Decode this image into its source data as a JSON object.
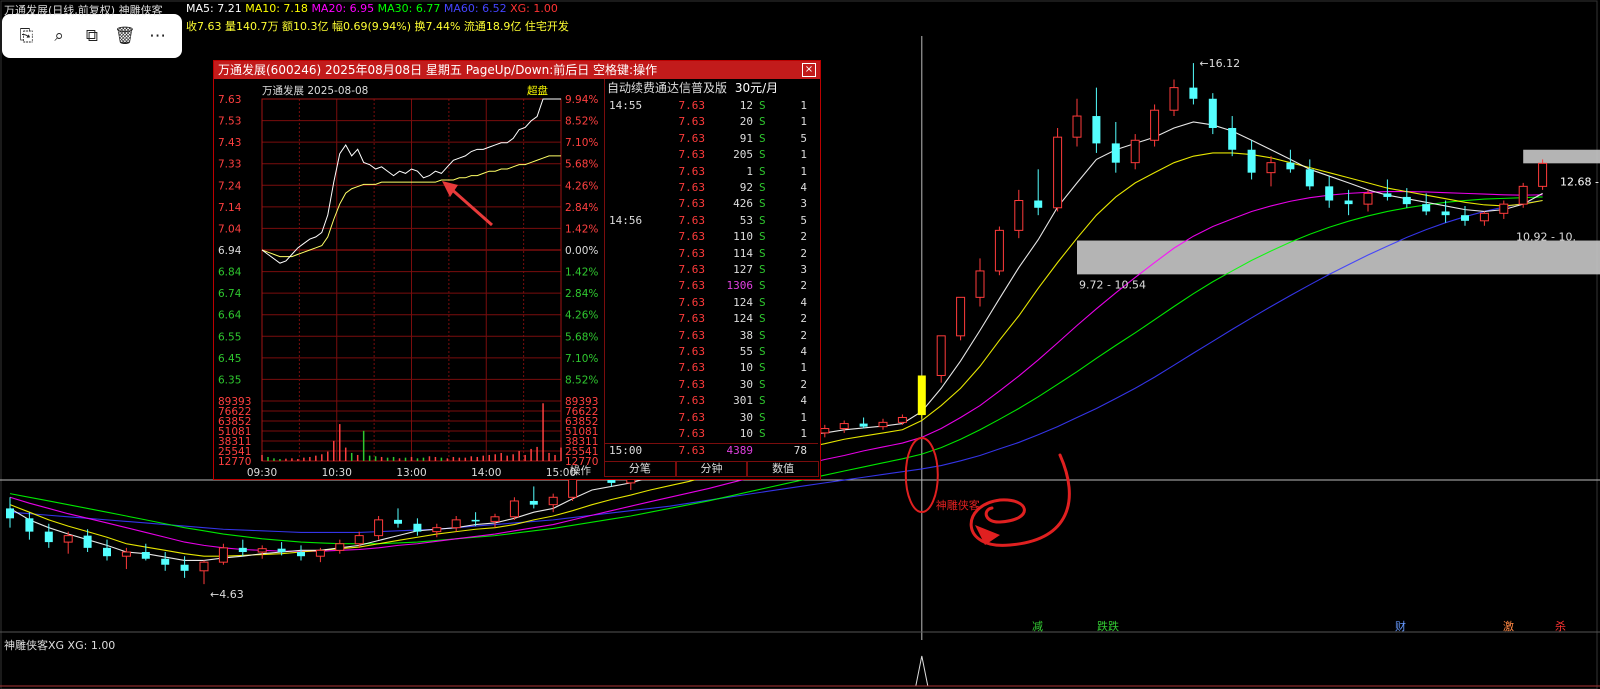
{
  "header": {
    "title": "万通发展(日线,前复权)",
    "indicator_name": "神雕侠客",
    "ma5": "MA5: 7.21",
    "ma10": "MA10: 7.18",
    "ma20": "MA20: 6.95",
    "ma30": "MA30: 6.77",
    "ma60": "MA60: 6.52",
    "xg": "XG: 1.00",
    "line2": "收7.63 量140.7万 额10.3亿 幅0.69(9.94%) 换7.44% 流通18.9亿 住宅开发"
  },
  "toolbar": {
    "icons": [
      "text-scan-icon",
      "image-search-icon",
      "crop-icon",
      "trash-icon",
      "more-icon"
    ],
    "labels": [
      "⎘",
      "⌕",
      "⧉",
      "🗑",
      "⋯"
    ]
  },
  "popup": {
    "title": "万通发展(600246) 2025年08月08日 星期五 PageUp/Down:前后日 空格键:操作",
    "chart_label": "万通发展  2025-08-08",
    "chart_mode": "超盘",
    "price_ticks": [
      "7.63",
      "7.53",
      "7.43",
      "7.33",
      "7.24",
      "7.14",
      "7.04",
      "6.94",
      "6.84",
      "6.74",
      "6.64",
      "6.55",
      "6.45",
      "6.35"
    ],
    "pct_ticks": [
      "9.94%",
      "8.52%",
      "7.10%",
      "5.68%",
      "4.26%",
      "2.84%",
      "1.42%",
      "0.00%",
      "1.42%",
      "2.84%",
      "4.26%",
      "5.68%",
      "7.10%",
      "8.52%"
    ],
    "vol_ticks": [
      "89393",
      "76622",
      "63852",
      "51081",
      "38311",
      "25541",
      "12770"
    ],
    "time_ticks": [
      "09:30",
      "10:30",
      "13:00",
      "14:00",
      "15:00"
    ],
    "op_label": "操作",
    "orderbook_header": "自动续费通达信普及版",
    "orderbook_price": "30元/月",
    "trades": [
      {
        "t": "14:55",
        "p": "7.63",
        "v": "12",
        "s": "S",
        "n": "1"
      },
      {
        "t": "",
        "p": "7.63",
        "v": "20",
        "s": "S",
        "n": "1"
      },
      {
        "t": "",
        "p": "7.63",
        "v": "91",
        "s": "S",
        "n": "5"
      },
      {
        "t": "",
        "p": "7.63",
        "v": "205",
        "s": "S",
        "n": "1"
      },
      {
        "t": "",
        "p": "7.63",
        "v": "1",
        "s": "S",
        "n": "1"
      },
      {
        "t": "",
        "p": "7.63",
        "v": "92",
        "s": "S",
        "n": "4"
      },
      {
        "t": "",
        "p": "7.63",
        "v": "426",
        "s": "S",
        "n": "3"
      },
      {
        "t": "14:56",
        "p": "7.63",
        "v": "53",
        "s": "S",
        "n": "5"
      },
      {
        "t": "",
        "p": "7.63",
        "v": "110",
        "s": "S",
        "n": "2"
      },
      {
        "t": "",
        "p": "7.63",
        "v": "114",
        "s": "S",
        "n": "2"
      },
      {
        "t": "",
        "p": "7.63",
        "v": "127",
        "s": "S",
        "n": "3"
      },
      {
        "t": "",
        "p": "7.63",
        "v": "1306",
        "s": "S",
        "n": "2"
      },
      {
        "t": "",
        "p": "7.63",
        "v": "124",
        "s": "S",
        "n": "4"
      },
      {
        "t": "",
        "p": "7.63",
        "v": "124",
        "s": "S",
        "n": "2"
      },
      {
        "t": "",
        "p": "7.63",
        "v": "38",
        "s": "S",
        "n": "2"
      },
      {
        "t": "",
        "p": "7.63",
        "v": "55",
        "s": "S",
        "n": "4"
      },
      {
        "t": "",
        "p": "7.63",
        "v": "10",
        "s": "S",
        "n": "1"
      },
      {
        "t": "",
        "p": "7.63",
        "v": "30",
        "s": "S",
        "n": "2"
      },
      {
        "t": "",
        "p": "7.63",
        "v": "301",
        "s": "S",
        "n": "4"
      },
      {
        "t": "",
        "p": "7.63",
        "v": "30",
        "s": "S",
        "n": "1"
      },
      {
        "t": "",
        "p": "7.63",
        "v": "10",
        "s": "S",
        "n": "1"
      },
      {
        "t": "15:00",
        "p": "7.63",
        "v": "4389",
        "s": "",
        "n": "78"
      }
    ],
    "tabs": [
      "分笔",
      "分钟",
      "数值"
    ]
  },
  "annotations": {
    "high": "16.12",
    "low": "4.63",
    "zone_right": "12.68 -",
    "zone_mid": "9.72 - 10.54",
    "zone_low": "10.92 - 10.",
    "signal_text": "神雕侠客",
    "tags": [
      "减",
      "跌跌",
      "财",
      "激",
      "杀"
    ]
  },
  "indicator": {
    "label": "神雕侠客XG  XG: 1.00"
  },
  "colors": {
    "up": "#ff3b3b",
    "down": "#54ffff",
    "ma5": "#ffffff",
    "ma10": "#ffff00",
    "ma20": "#ff00ff",
    "ma30": "#00ff00",
    "ma60": "#3a3aff",
    "zone": "#c8c8c8",
    "signal": "#ffff00",
    "accent": "#c21b1b"
  },
  "chart_data": {
    "type": "candlestick",
    "title": "万通发展(日线,前复权)",
    "price_range": [
      4.63,
      16.12
    ],
    "ohlc": [
      [
        5.55,
        5.7,
        5.3,
        5.42
      ],
      [
        5.42,
        5.5,
        5.15,
        5.25
      ],
      [
        5.25,
        5.35,
        5.05,
        5.12
      ],
      [
        5.12,
        5.25,
        4.98,
        5.2
      ],
      [
        5.2,
        5.28,
        5.0,
        5.05
      ],
      [
        5.05,
        5.15,
        4.9,
        4.95
      ],
      [
        4.95,
        5.05,
        4.8,
        5.0
      ],
      [
        5.0,
        5.1,
        4.9,
        4.92
      ],
      [
        4.92,
        5.0,
        4.78,
        4.85
      ],
      [
        4.85,
        4.95,
        4.7,
        4.78
      ],
      [
        4.78,
        4.9,
        4.63,
        4.88
      ],
      [
        4.88,
        5.1,
        4.85,
        5.05
      ],
      [
        5.05,
        5.15,
        4.95,
        5.0
      ],
      [
        5.0,
        5.08,
        4.92,
        5.04
      ],
      [
        5.04,
        5.12,
        4.96,
        5.0
      ],
      [
        5.0,
        5.08,
        4.9,
        4.95
      ],
      [
        4.95,
        5.05,
        4.88,
        5.02
      ],
      [
        5.02,
        5.15,
        4.98,
        5.1
      ],
      [
        5.1,
        5.25,
        5.05,
        5.2
      ],
      [
        5.2,
        5.45,
        5.15,
        5.4
      ],
      [
        5.4,
        5.55,
        5.3,
        5.35
      ],
      [
        5.35,
        5.42,
        5.2,
        5.25
      ],
      [
        5.25,
        5.35,
        5.18,
        5.3
      ],
      [
        5.3,
        5.45,
        5.25,
        5.4
      ],
      [
        5.4,
        5.5,
        5.32,
        5.38
      ],
      [
        5.38,
        5.48,
        5.3,
        5.44
      ],
      [
        5.44,
        5.7,
        5.4,
        5.65
      ],
      [
        5.65,
        5.85,
        5.55,
        5.6
      ],
      [
        5.6,
        5.75,
        5.5,
        5.7
      ],
      [
        5.7,
        6.1,
        5.65,
        6.05
      ],
      [
        6.05,
        6.3,
        5.95,
        6.0
      ],
      [
        6.0,
        6.15,
        5.85,
        5.9
      ],
      [
        5.9,
        6.05,
        5.8,
        6.0
      ],
      [
        6.0,
        6.2,
        5.95,
        6.15
      ],
      [
        6.15,
        6.4,
        6.05,
        6.1
      ],
      [
        6.1,
        6.25,
        6.0,
        6.2
      ],
      [
        6.2,
        6.45,
        6.15,
        6.4
      ],
      [
        6.4,
        6.7,
        6.35,
        6.65
      ],
      [
        6.65,
        6.8,
        6.5,
        6.55
      ],
      [
        6.55,
        6.7,
        6.45,
        6.6
      ],
      [
        6.6,
        6.75,
        6.55,
        6.7
      ],
      [
        6.7,
        6.8,
        6.6,
        6.65
      ],
      [
        6.65,
        6.78,
        6.58,
        6.72
      ],
      [
        6.72,
        6.85,
        6.65,
        6.8
      ],
      [
        6.8,
        6.9,
        6.72,
        6.75
      ],
      [
        6.75,
        6.88,
        6.7,
        6.82
      ],
      [
        6.82,
        6.95,
        6.78,
        6.9
      ],
      [
        6.94,
        7.63,
        6.88,
        7.63
      ],
      [
        7.63,
        8.39,
        7.5,
        8.39
      ],
      [
        8.39,
        9.2,
        8.3,
        9.2
      ],
      [
        9.2,
        10.1,
        9.0,
        9.8
      ],
      [
        9.8,
        10.9,
        9.7,
        10.8
      ],
      [
        10.8,
        11.9,
        10.6,
        11.6
      ],
      [
        11.6,
        12.5,
        11.2,
        11.4
      ],
      [
        11.4,
        13.8,
        11.3,
        13.5
      ],
      [
        13.5,
        14.8,
        13.2,
        14.2
      ],
      [
        14.2,
        15.2,
        13.0,
        13.3
      ],
      [
        13.3,
        14.0,
        12.4,
        12.7
      ],
      [
        12.7,
        13.6,
        12.5,
        13.4
      ],
      [
        13.4,
        14.6,
        13.2,
        14.4
      ],
      [
        14.4,
        15.5,
        14.2,
        15.2
      ],
      [
        15.2,
        16.12,
        14.6,
        14.8
      ],
      [
        14.8,
        15.0,
        13.6,
        13.8
      ],
      [
        13.8,
        14.2,
        12.9,
        13.1
      ],
      [
        13.1,
        13.4,
        12.2,
        12.4
      ],
      [
        12.4,
        12.9,
        12.0,
        12.7
      ],
      [
        12.7,
        13.1,
        12.4,
        12.5
      ],
      [
        12.5,
        12.8,
        11.9,
        12.0
      ],
      [
        12.0,
        12.3,
        11.4,
        11.6
      ],
      [
        11.6,
        11.9,
        11.2,
        11.5
      ],
      [
        11.5,
        11.9,
        11.3,
        11.8
      ],
      [
        11.8,
        12.2,
        11.6,
        11.7
      ],
      [
        11.7,
        11.95,
        11.4,
        11.5
      ],
      [
        11.5,
        11.8,
        11.2,
        11.3
      ],
      [
        11.3,
        11.6,
        11.0,
        11.2
      ],
      [
        11.2,
        11.45,
        10.92,
        11.05
      ],
      [
        11.05,
        11.3,
        10.92,
        11.25
      ],
      [
        11.25,
        11.6,
        11.1,
        11.5
      ],
      [
        11.5,
        12.1,
        11.4,
        12.0
      ],
      [
        12.0,
        12.8,
        11.9,
        12.68
      ]
    ],
    "ma5_line": [
      5.55,
      5.4,
      5.3,
      5.22,
      5.15,
      5.08,
      5.0,
      4.98,
      4.94,
      4.9,
      4.9,
      4.93,
      4.95,
      4.98,
      5.0,
      5.02,
      5.02,
      5.05,
      5.08,
      5.14,
      5.2,
      5.26,
      5.28,
      5.3,
      5.34,
      5.36,
      5.42,
      5.5,
      5.55,
      5.68,
      5.8,
      5.85,
      5.9,
      5.98,
      6.03,
      6.08,
      6.17,
      6.3,
      6.42,
      6.5,
      6.58,
      6.62,
      6.65,
      6.7,
      6.73,
      6.76,
      6.8,
      7.0,
      7.4,
      7.9,
      8.5,
      9.17,
      9.88,
      10.56,
      11.42,
      12.1,
      12.8,
      13.1,
      13.3,
      13.5,
      13.8,
      14.0,
      13.9,
      13.7,
      13.4,
      13.1,
      12.8,
      12.5,
      12.3,
      12.1,
      11.9,
      11.75,
      11.65,
      11.55,
      11.45,
      11.35,
      11.3,
      11.35,
      11.5,
      11.8
    ],
    "ma10_line": [
      5.6,
      5.5,
      5.4,
      5.32,
      5.25,
      5.18,
      5.1,
      5.06,
      5.02,
      4.98,
      4.95,
      4.95,
      4.96,
      4.97,
      4.98,
      5.0,
      5.02,
      5.04,
      5.06,
      5.1,
      5.14,
      5.18,
      5.22,
      5.25,
      5.28,
      5.3,
      5.34,
      5.4,
      5.45,
      5.52,
      5.6,
      5.67,
      5.73,
      5.8,
      5.86,
      5.92,
      6.0,
      6.1,
      6.2,
      6.28,
      6.35,
      6.42,
      6.48,
      6.55,
      6.6,
      6.65,
      6.7,
      6.85,
      7.1,
      7.4,
      7.8,
      8.3,
      8.8,
      9.4,
      10.0,
      10.6,
      11.2,
      11.7,
      12.1,
      12.4,
      12.7,
      12.9,
      13.0,
      13.0,
      12.95,
      12.85,
      12.7,
      12.55,
      12.4,
      12.25,
      12.1,
      11.95,
      11.85,
      11.75,
      11.65,
      11.55,
      11.48,
      11.45,
      11.5,
      11.6
    ],
    "ma20_line": [
      5.7,
      5.62,
      5.55,
      5.48,
      5.42,
      5.36,
      5.3,
      5.24,
      5.18,
      5.12,
      5.08,
      5.05,
      5.03,
      5.02,
      5.01,
      5.01,
      5.01,
      5.02,
      5.03,
      5.05,
      5.08,
      5.1,
      5.13,
      5.16,
      5.19,
      5.22,
      5.26,
      5.3,
      5.34,
      5.4,
      5.46,
      5.52,
      5.58,
      5.64,
      5.7,
      5.76,
      5.82,
      5.89,
      5.96,
      6.03,
      6.1,
      6.17,
      6.24,
      6.3,
      6.37,
      6.43,
      6.49,
      6.58,
      6.72,
      6.9,
      7.1,
      7.35,
      7.62,
      7.92,
      8.25,
      8.6,
      8.95,
      9.3,
      9.65,
      10.0,
      10.35,
      10.65,
      10.9,
      11.1,
      11.3,
      11.45,
      11.58,
      11.68,
      11.75,
      11.8,
      11.83,
      11.85,
      11.85,
      11.84,
      11.82,
      11.8,
      11.78,
      11.76,
      11.75,
      11.76
    ],
    "ma30_line": [
      5.75,
      5.7,
      5.65,
      5.6,
      5.55,
      5.5,
      5.45,
      5.4,
      5.35,
      5.3,
      5.26,
      5.22,
      5.19,
      5.16,
      5.14,
      5.12,
      5.11,
      5.1,
      5.1,
      5.1,
      5.11,
      5.12,
      5.14,
      5.16,
      5.18,
      5.2,
      5.23,
      5.26,
      5.29,
      5.33,
      5.37,
      5.41,
      5.45,
      5.5,
      5.55,
      5.6,
      5.65,
      5.71,
      5.77,
      5.83,
      5.89,
      5.95,
      6.01,
      6.07,
      6.13,
      6.19,
      6.25,
      6.32,
      6.42,
      6.55,
      6.7,
      6.87,
      7.05,
      7.25,
      7.47,
      7.7,
      7.95,
      8.2,
      8.45,
      8.72,
      9.0,
      9.28,
      9.55,
      9.8,
      10.05,
      10.28,
      10.5,
      10.7,
      10.88,
      11.04,
      11.18,
      11.3,
      11.4,
      11.48,
      11.55,
      11.6,
      11.64,
      11.66,
      11.68,
      11.7
    ],
    "ma60_line": [
      5.5,
      5.48,
      5.46,
      5.44,
      5.42,
      5.4,
      5.38,
      5.36,
      5.34,
      5.32,
      5.3,
      5.28,
      5.27,
      5.26,
      5.25,
      5.24,
      5.24,
      5.24,
      5.24,
      5.25,
      5.26,
      5.27,
      5.28,
      5.3,
      5.32,
      5.34,
      5.36,
      5.38,
      5.4,
      5.43,
      5.46,
      5.49,
      5.52,
      5.55,
      5.58,
      5.62,
      5.66,
      5.7,
      5.74,
      5.78,
      5.82,
      5.86,
      5.9,
      5.94,
      5.98,
      6.02,
      6.06,
      6.1,
      6.15,
      6.22,
      6.3,
      6.4,
      6.5,
      6.62,
      6.75,
      6.9,
      7.05,
      7.22,
      7.4,
      7.6,
      7.82,
      8.05,
      8.28,
      8.52,
      8.76,
      9.0,
      9.24,
      9.48,
      9.72,
      9.95,
      10.18,
      10.4,
      10.62,
      10.82,
      11.0,
      11.16,
      11.3,
      11.42,
      11.52,
      11.6
    ],
    "signal_index": 47,
    "zones": [
      {
        "from": 9.72,
        "to": 10.54
      },
      {
        "from": 12.68,
        "to": 13.1
      }
    ]
  },
  "intraday": {
    "pre_close": 6.94,
    "price": [
      6.94,
      6.92,
      6.9,
      6.88,
      6.89,
      6.92,
      6.95,
      6.97,
      6.99,
      7.0,
      7.02,
      7.1,
      7.25,
      7.38,
      7.42,
      7.37,
      7.4,
      7.34,
      7.33,
      7.31,
      7.32,
      7.3,
      7.28,
      7.3,
      7.29,
      7.31,
      7.3,
      7.27,
      7.28,
      7.3,
      7.29,
      7.32,
      7.35,
      7.36,
      7.37,
      7.39,
      7.4,
      7.4,
      7.41,
      7.42,
      7.43,
      7.43,
      7.45,
      7.49,
      7.5,
      7.53,
      7.55,
      7.63,
      7.63,
      7.63,
      7.63
    ],
    "avg": [
      6.94,
      6.93,
      6.92,
      6.91,
      6.91,
      6.91,
      6.92,
      6.93,
      6.94,
      6.95,
      6.96,
      7.0,
      7.08,
      7.15,
      7.2,
      7.22,
      7.23,
      7.24,
      7.24,
      7.24,
      7.25,
      7.25,
      7.25,
      7.25,
      7.25,
      7.25,
      7.25,
      7.25,
      7.25,
      7.25,
      7.26,
      7.26,
      7.26,
      7.27,
      7.27,
      7.28,
      7.28,
      7.29,
      7.3,
      7.3,
      7.31,
      7.31,
      7.32,
      7.33,
      7.33,
      7.34,
      7.35,
      7.36,
      7.37,
      7.37,
      7.37
    ],
    "volume": [
      9000,
      6000,
      4000,
      3000,
      3500,
      4000,
      3000,
      5000,
      6000,
      8000,
      10000,
      14000,
      30000,
      55000,
      20000,
      12000,
      9000,
      45000,
      8000,
      7000,
      6000,
      5000,
      6000,
      4000,
      5000,
      6000,
      4000,
      5000,
      7000,
      6000,
      5000,
      4000,
      6000,
      5000,
      5000,
      7000,
      6000,
      8000,
      9000,
      10000,
      12000,
      8000,
      10000,
      15000,
      9000,
      18000,
      21000,
      86000,
      12000,
      9000,
      20000
    ]
  }
}
